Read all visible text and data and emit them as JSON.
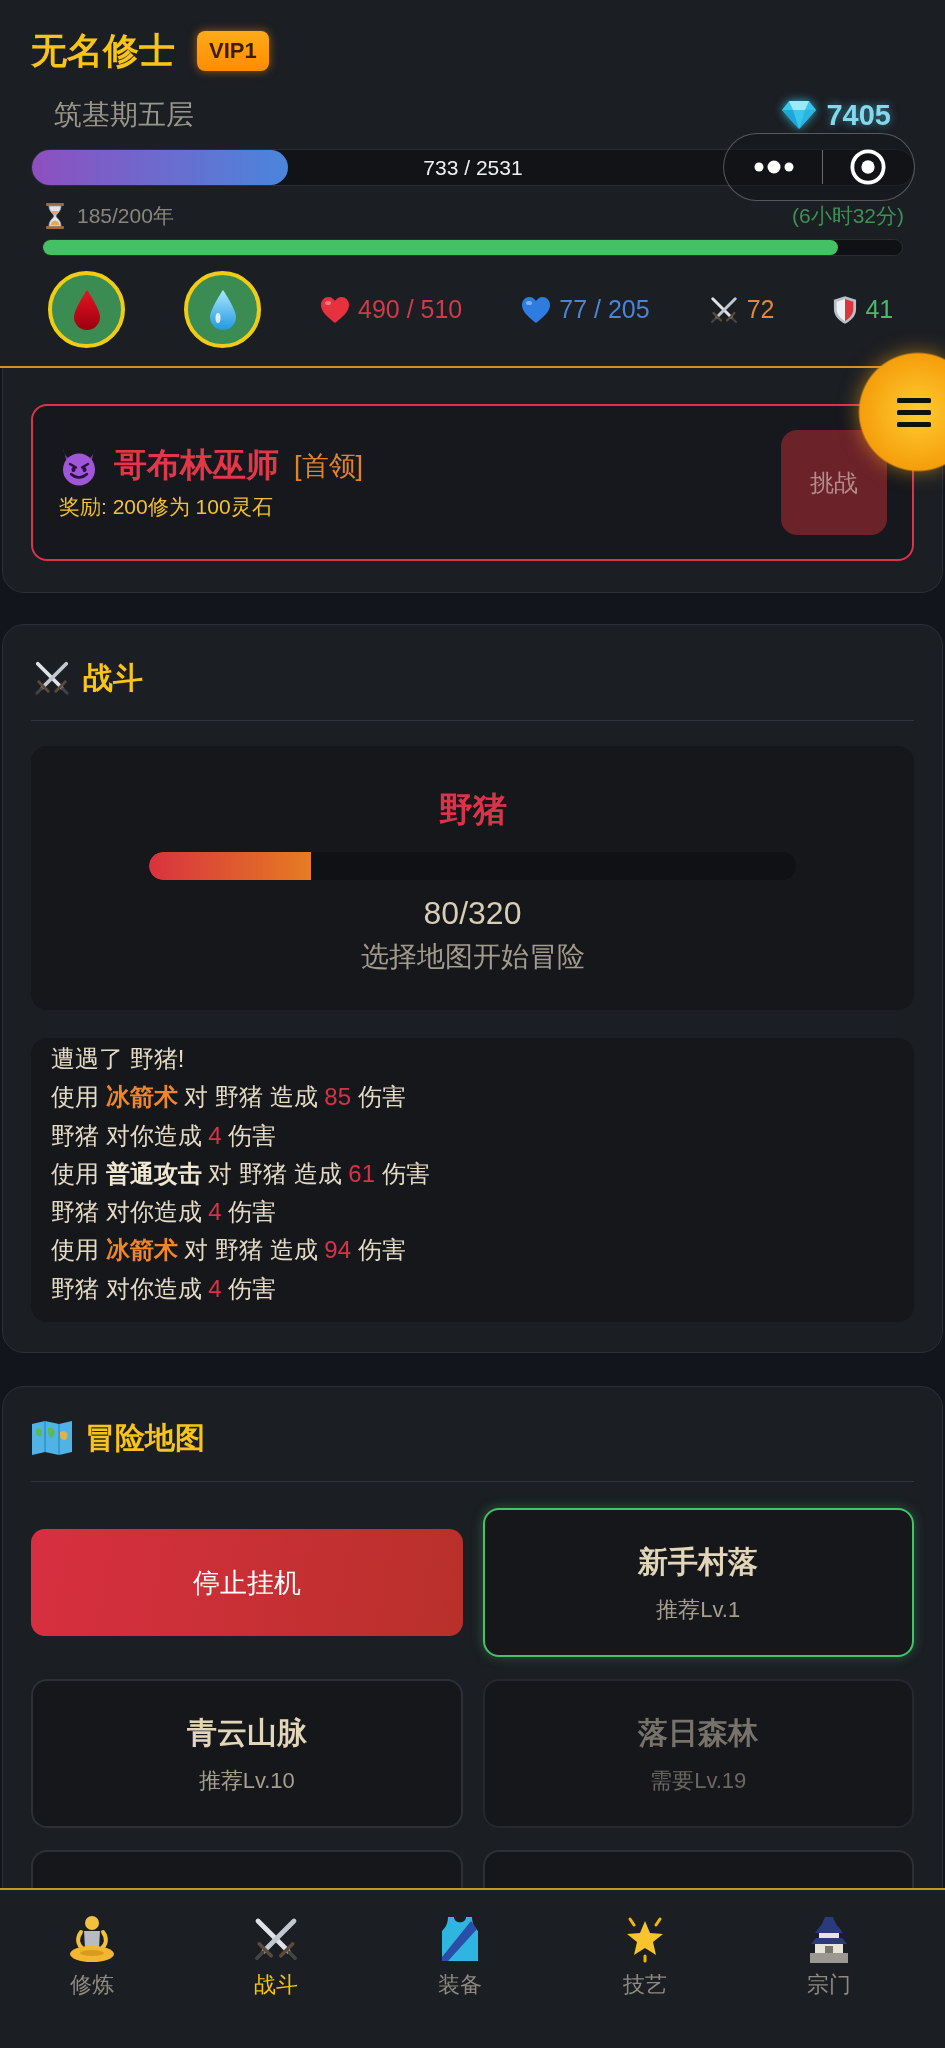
{
  "player": {
    "name": "无名修士",
    "vip": "VIP1",
    "realm": "筑基期五层",
    "spirit_stones": "7405",
    "cultivation": {
      "reading": "733 / 2531",
      "level": 0.29
    },
    "lifespan": {
      "reading": "185/200年",
      "remaining": "(6小时32分)",
      "level": 0.925
    }
  },
  "potions": [
    {
      "kind": "blood"
    },
    {
      "kind": "water"
    }
  ],
  "stats": [
    {
      "kind": "hp",
      "value": "490 / 510"
    },
    {
      "kind": "mp",
      "value": "77 / 205"
    },
    {
      "kind": "attack",
      "value": "72"
    },
    {
      "kind": "defense",
      "value": "41"
    }
  ],
  "boss": {
    "name": "哥布林巫师",
    "tag": "[首领]",
    "reward": "奖励: 200修为 100灵石",
    "button": {
      "label": "挑战",
      "disabled": true
    }
  },
  "battle": {
    "title": "战斗",
    "enemy": {
      "name": "野猪",
      "level": 0.25,
      "hp": "80/320",
      "status": "选择地图开始冒险"
    },
    "log": [
      {
        "parts": [
          {
            "kind": "text",
            "text": "遭遇了 野猪!"
          }
        ]
      },
      {
        "parts": [
          {
            "kind": "text",
            "text": "使用 "
          },
          {
            "kind": "skill",
            "text": "冰箭术"
          },
          {
            "kind": "text",
            "text": " 对 野猪 造成 "
          },
          {
            "kind": "damage",
            "text": "85"
          },
          {
            "kind": "text",
            "text": " 伤害"
          }
        ]
      },
      {
        "parts": [
          {
            "kind": "text",
            "text": "野猪 对你造成 "
          },
          {
            "kind": "damage",
            "text": "4"
          },
          {
            "kind": "text",
            "text": " 伤害"
          }
        ]
      },
      {
        "parts": [
          {
            "kind": "text",
            "text": "使用 "
          },
          {
            "kind": "attack",
            "text": "普通攻击"
          },
          {
            "kind": "text",
            "text": " 对 野猪 造成 "
          },
          {
            "kind": "damage",
            "text": "61"
          },
          {
            "kind": "text",
            "text": " 伤害"
          }
        ]
      },
      {
        "parts": [
          {
            "kind": "text",
            "text": "野猪 对你造成 "
          },
          {
            "kind": "damage",
            "text": "4"
          },
          {
            "kind": "text",
            "text": " 伤害"
          }
        ]
      },
      {
        "parts": [
          {
            "kind": "text",
            "text": "使用 "
          },
          {
            "kind": "skill",
            "text": "冰箭术"
          },
          {
            "kind": "text",
            "text": " 对 野猪 造成 "
          },
          {
            "kind": "damage",
            "text": "94"
          },
          {
            "kind": "text",
            "text": " 伤害"
          }
        ]
      },
      {
        "parts": [
          {
            "kind": "text",
            "text": "野猪 对你造成 "
          },
          {
            "kind": "damage",
            "text": "4"
          },
          {
            "kind": "text",
            "text": " 伤害"
          }
        ]
      }
    ]
  },
  "map": {
    "title": "冒险地图",
    "stop_button": "停止挂机",
    "maps": [
      {
        "name": "新手村落",
        "requirement": "推荐Lv.1",
        "selected": true,
        "locked": false
      },
      {
        "name": "青云山脉",
        "requirement": "推荐Lv.10",
        "selected": false,
        "locked": false
      },
      {
        "name": "落日森林",
        "requirement": "需要Lv.19",
        "selected": false,
        "locked": true
      },
      {
        "selected": false
      },
      {
        "selected": false
      }
    ]
  },
  "nav": [
    {
      "kind": "meditate",
      "label": "修炼",
      "selected": false
    },
    {
      "kind": "battle",
      "label": "战斗",
      "selected": true
    },
    {
      "kind": "equipment",
      "label": "装备",
      "selected": false
    },
    {
      "kind": "skills",
      "label": "技艺",
      "selected": false
    },
    {
      "kind": "sect",
      "label": "宗门",
      "selected": false
    }
  ]
}
